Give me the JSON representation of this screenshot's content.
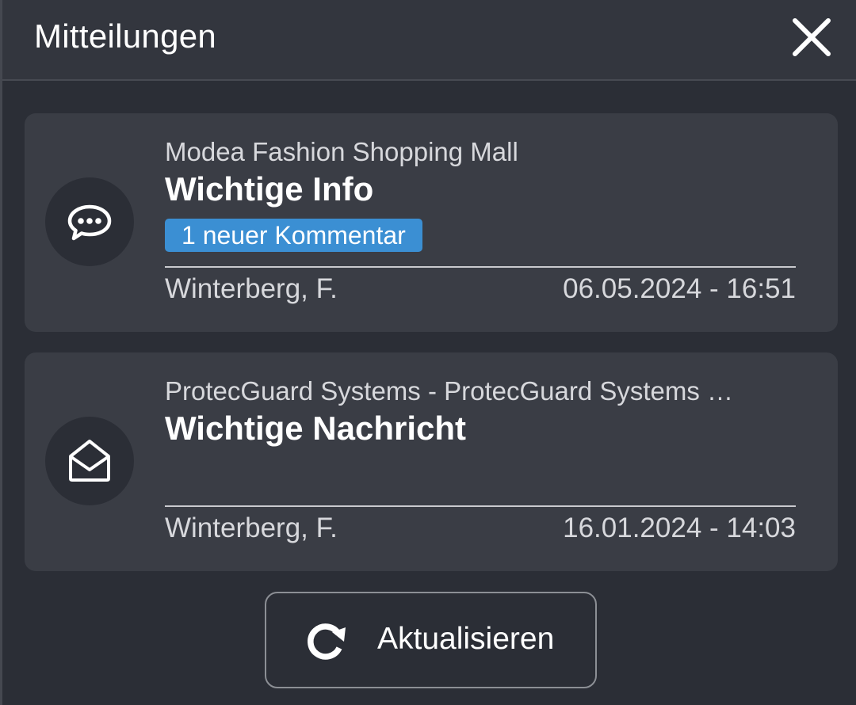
{
  "header": {
    "title": "Mitteilungen",
    "close_icon": "close-icon"
  },
  "notifications": [
    {
      "icon": "chat-bubble-icon",
      "sender": "Modea Fashion Shopping Mall",
      "title": "Wichtige Info",
      "badge": "1 neuer Kommentar",
      "author": "Winterberg, F.",
      "date": "06.05.2024 - 16:51"
    },
    {
      "icon": "open-envelope-icon",
      "sender": "ProtecGuard Systems - ProtecGuard Systems …",
      "title": "Wichtige Nachricht",
      "author": "Winterberg, F.",
      "date": "16.01.2024 - 14:03"
    }
  ],
  "refresh": {
    "icon": "refresh-icon",
    "label": "Aktualisieren"
  },
  "colors": {
    "background": "#2b2e36",
    "header": "#33363e",
    "card": "#3a3d45",
    "badge": "#3b8fd3",
    "text": "#ffffff",
    "muted_text": "#d7d8dc"
  }
}
